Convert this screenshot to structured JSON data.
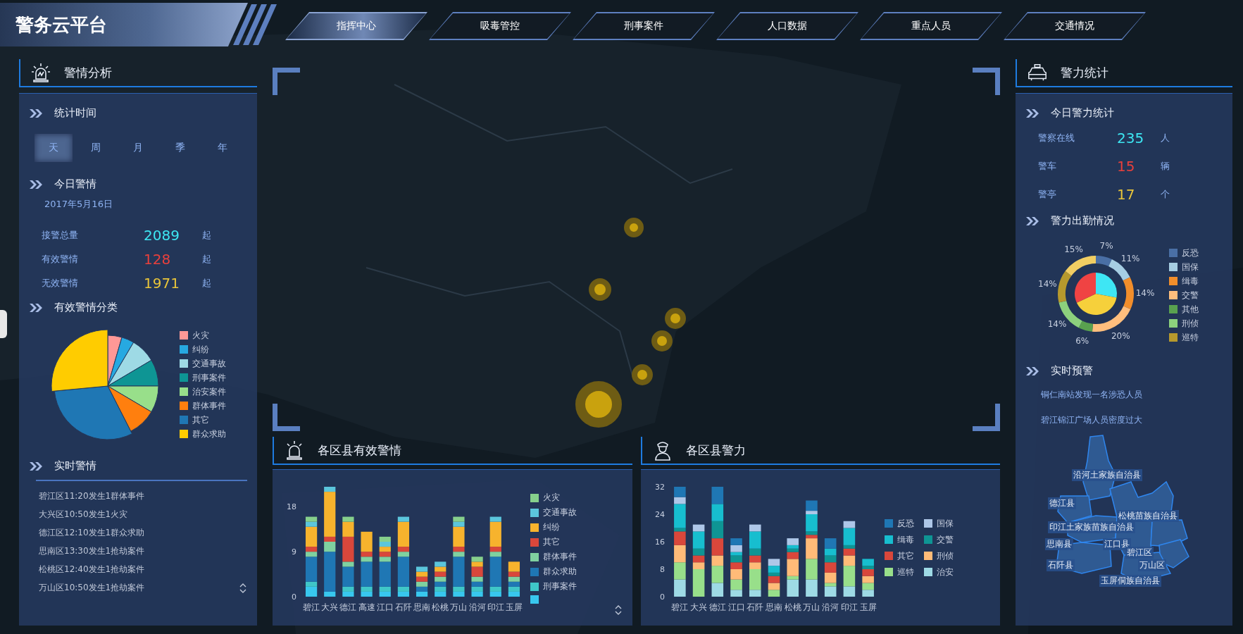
{
  "header": {
    "title": "警务云平台",
    "nav": [
      {
        "label": "指挥中心",
        "selected": true
      },
      {
        "label": "吸毒管控",
        "selected": false
      },
      {
        "label": "刑事案件",
        "selected": false
      },
      {
        "label": "人口数据",
        "selected": false
      },
      {
        "label": "重点人员",
        "selected": false
      },
      {
        "label": "交通情况",
        "selected": false
      }
    ]
  },
  "left_panel": {
    "title": "警情分析",
    "stat_time": {
      "heading": "统计时间",
      "periods": [
        {
          "label": "天",
          "selected": true
        },
        {
          "label": "周",
          "selected": false
        },
        {
          "label": "月",
          "selected": false
        },
        {
          "label": "季",
          "selected": false
        },
        {
          "label": "年",
          "selected": false
        }
      ]
    },
    "today": {
      "heading": "今日警情",
      "date": "2017年5月16日",
      "stats": [
        {
          "label": "接警总量",
          "value": "2089",
          "unit": "起",
          "color": "#3de6f2"
        },
        {
          "label": "有效警情",
          "value": "128",
          "unit": "起",
          "color": "#e8403c"
        },
        {
          "label": "无效警情",
          "value": "1971",
          "unit": "起",
          "color": "#e9c53a"
        }
      ]
    },
    "category": {
      "heading": "有效警情分类",
      "legend": [
        {
          "label": "火灾",
          "color": "#ff9896"
        },
        {
          "label": "纠纷",
          "color": "#27a9e1"
        },
        {
          "label": "交通事故",
          "color": "#9edae5"
        },
        {
          "label": "刑事案件",
          "color": "#0e9594"
        },
        {
          "label": "治安案件",
          "color": "#98df8a"
        },
        {
          "label": "群体事件",
          "color": "#ff7f0e"
        },
        {
          "label": "其它",
          "color": "#1f77b4"
        },
        {
          "label": "群众求助",
          "color": "#ffcc00"
        }
      ]
    },
    "realtime": {
      "heading": "实时警情",
      "items": [
        "碧江区11:20发生1群体事件",
        "大兴区10:50发生1火灾",
        "德江区12:10发生1群众求助",
        "思南区13:30发生1抢劫案件",
        "松桃区12:40发生1抢劫案件",
        "万山区10:50发生1抢劫案件"
      ]
    }
  },
  "district_alerts": {
    "title": "各区县有效警情",
    "chart_data": {
      "type": "bar",
      "stacked": true,
      "categories": [
        "碧江",
        "大兴",
        "德江",
        "高速",
        "江口",
        "石阡",
        "思南",
        "松桃",
        "万山",
        "沿河",
        "印江",
        "玉屏"
      ],
      "ylim": [
        0,
        22
      ],
      "yticks": [
        0,
        9,
        18
      ],
      "series": [
        {
          "name": "火灾",
          "color": "#86d08c",
          "values": [
            1,
            0,
            1,
            0,
            1,
            0,
            0,
            0,
            1,
            1,
            0,
            0
          ]
        },
        {
          "name": "交通事故",
          "color": "#5bc6dc",
          "values": [
            1,
            1,
            0,
            0,
            1,
            1,
            1,
            1,
            1,
            0,
            1,
            0
          ]
        },
        {
          "name": "纠纷",
          "color": "#f7b32d",
          "values": [
            4,
            9,
            3,
            4,
            1,
            5,
            1,
            1,
            4,
            1,
            5,
            2
          ]
        },
        {
          "name": "其它",
          "color": "#d9473b",
          "values": [
            1,
            1,
            5,
            1,
            1,
            1,
            1,
            1,
            1,
            2,
            1,
            1
          ]
        },
        {
          "name": "群体事件",
          "color": "#7fd1a0",
          "values": [
            1,
            2,
            1,
            1,
            1,
            1,
            1,
            1,
            1,
            1,
            1,
            1
          ]
        },
        {
          "name": "群众求助",
          "color": "#1f77b4",
          "values": [
            5,
            8,
            4,
            5,
            5,
            6,
            1,
            1,
            6,
            1,
            6,
            1
          ]
        },
        {
          "name": "刑事案件",
          "color": "#3fc6c8",
          "values": [
            1,
            0,
            1,
            1,
            1,
            1,
            0,
            1,
            1,
            1,
            1,
            1
          ]
        },
        {
          "color": "#38c7ee",
          "values": [
            2,
            1,
            1,
            1,
            1,
            1,
            1,
            1,
            1,
            1,
            1,
            1
          ]
        }
      ]
    }
  },
  "district_police": {
    "title": "各区县警力",
    "chart_data": {
      "type": "bar",
      "stacked": true,
      "categories": [
        "碧江",
        "大兴",
        "德江",
        "江口",
        "石阡",
        "思南",
        "松桃",
        "万山",
        "沿河",
        "印江",
        "玉屏"
      ],
      "ylim": [
        0,
        32
      ],
      "yticks": [
        0,
        8,
        16,
        24,
        32
      ],
      "series": [
        {
          "name": "反恐",
          "color": "#1f77b4",
          "values": [
            3,
            0,
            5,
            2,
            0,
            0,
            0,
            3,
            3,
            0,
            0
          ]
        },
        {
          "name": "国保",
          "color": "#aec7e8",
          "values": [
            2,
            2,
            0,
            2,
            2,
            2,
            2,
            1,
            0,
            2,
            0
          ]
        },
        {
          "name": "缉毒",
          "color": "#17becf",
          "values": [
            7,
            5,
            5,
            1,
            5,
            2,
            1,
            5,
            2,
            5,
            2
          ]
        },
        {
          "name": "交警",
          "color": "#0e9594",
          "values": [
            1,
            2,
            5,
            2,
            2,
            1,
            1,
            1,
            2,
            1,
            1
          ]
        },
        {
          "name": "其它",
          "color": "#d9473b",
          "values": [
            4,
            2,
            5,
            2,
            2,
            2,
            2,
            1,
            3,
            2,
            2
          ]
        },
        {
          "name": "刑侦",
          "color": "#ffbb78",
          "values": [
            5,
            2,
            3,
            3,
            2,
            2,
            5,
            6,
            3,
            3,
            2
          ]
        },
        {
          "name": "巡特",
          "color": "#98df8a",
          "values": [
            5,
            8,
            5,
            3,
            6,
            2,
            1,
            6,
            1,
            6,
            2
          ]
        },
        {
          "name": "治安",
          "color": "#9edae5",
          "values": [
            5,
            0,
            4,
            2,
            2,
            0,
            5,
            5,
            3,
            3,
            2
          ]
        }
      ]
    }
  },
  "right_panel": {
    "title": "警力统计",
    "today": {
      "heading": "今日警力统计",
      "stats": [
        {
          "label": "警察在线",
          "value": "235",
          "unit": "人",
          "color": "#3de6f2"
        },
        {
          "label": "警车",
          "value": "15",
          "unit": "辆",
          "color": "#e8403c"
        },
        {
          "label": "警亭",
          "value": "17",
          "unit": "个",
          "color": "#e9c53a"
        }
      ]
    },
    "deployment": {
      "heading": "警力出勤情况",
      "chart_data": {
        "type": "donut",
        "series": [
          {
            "values": [
              7,
              11,
              14,
              20,
              6,
              14,
              14,
              15
            ],
            "colors": [
              "#4a6fa5",
              "#a6cee3",
              "#f28e2b",
              "#ffbe7d",
              "#59a14f",
              "#8cd17d",
              "#b6992d",
              "#f1ce63"
            ],
            "value_labels": [
              "7%",
              "11%",
              "14%",
              "20%",
              "6%",
              "14%",
              "14%",
              "15%"
            ],
            "data_labels": true
          },
          {
            "values": [
              28,
              40,
              32
            ],
            "colors": [
              "#3ee6f4",
              "#f6d03b",
              "#f04343"
            ]
          }
        ]
      },
      "legend": [
        {
          "label": "反恐",
          "color": "#4a6fa5"
        },
        {
          "label": "国保",
          "color": "#a6cee3"
        },
        {
          "label": "缉毒",
          "color": "#f28e2b"
        },
        {
          "label": "交警",
          "color": "#ffbe7d"
        },
        {
          "label": "其他",
          "color": "#59a14f"
        },
        {
          "label": "刑侦",
          "color": "#8cd17d"
        },
        {
          "label": "巡特",
          "color": "#b6992d"
        }
      ]
    },
    "alerts": {
      "heading": "实时预警",
      "items": [
        "铜仁南站发现一名涉恐人员",
        "碧江锦江广场人员密度过大"
      ]
    },
    "region_map": {
      "labels": [
        "沿河土家族自治县",
        "德江县",
        "松桃苗族自治县",
        "印江土家族苗族自治县",
        "思南县",
        "江口县",
        "碧江区",
        "万山区",
        "石阡县",
        "玉屏侗族自治县"
      ]
    }
  }
}
